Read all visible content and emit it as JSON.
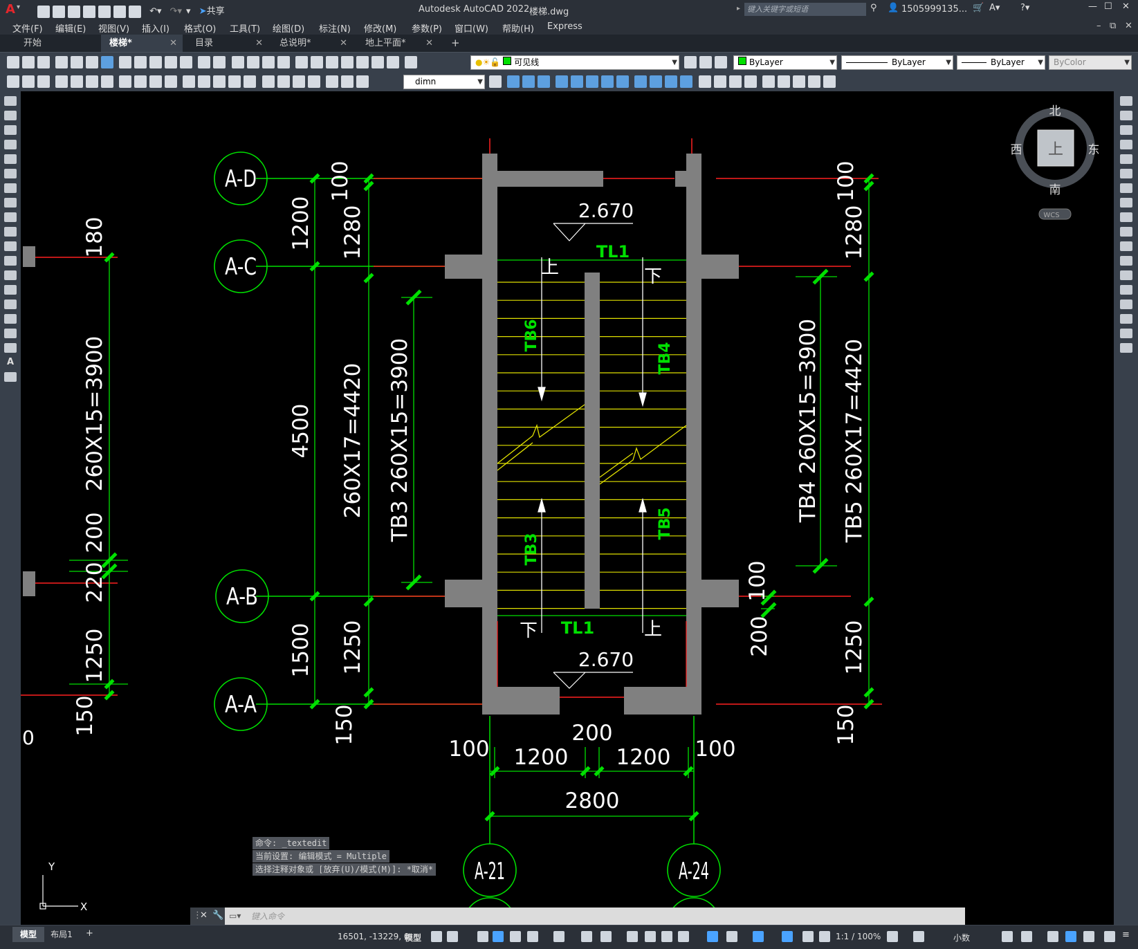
{
  "app": {
    "logo": "A",
    "title": "Autodesk AutoCAD 2022",
    "filename": "楼梯.dwg",
    "share": "共享",
    "search_placeholder": "键入关键字或短语",
    "user": "1505999135...",
    "colors": {
      "accent": "#d9262c",
      "green": "#00e000",
      "red": "#ff2020",
      "yellow": "#e0e000",
      "wall": "#808080"
    }
  },
  "menu": [
    "文件(F)",
    "编辑(E)",
    "视图(V)",
    "插入(I)",
    "格式(O)",
    "工具(T)",
    "绘图(D)",
    "标注(N)",
    "修改(M)",
    "参数(P)",
    "窗口(W)",
    "帮助(H)",
    "Express"
  ],
  "tabs": [
    {
      "label": "开始"
    },
    {
      "label": "楼梯*"
    },
    {
      "label": "目录"
    },
    {
      "label": "总说明*"
    },
    {
      "label": "地上平面*"
    }
  ],
  "toolbar": {
    "layer": "可见线",
    "color": "ByLayer",
    "linetype": "ByLayer",
    "lineweight": "ByLayer",
    "plotstyle": "ByColor",
    "dimstyle": "dimn"
  },
  "viewcube": {
    "north": "北",
    "south": "南",
    "east": "东",
    "west": "西",
    "top": "上",
    "wcs": "WCS"
  },
  "drawing": {
    "axes_left": [
      "A-D",
      "A-C",
      "A-B",
      "A-A"
    ],
    "axes_bottom": [
      "A-21",
      "A-24"
    ],
    "elev_top": "2.670",
    "elev_bottom": "2.670",
    "beam_top": "TL1",
    "beam_bottom": "TL1",
    "stairs": [
      "TB6",
      "TB4",
      "TB3",
      "TB5"
    ],
    "up": "上",
    "down": "下",
    "dims_col1": [
      "1200",
      "4500",
      "1500"
    ],
    "dims_col2": [
      "100",
      "1280",
      "260X17=4420",
      "1250",
      "150"
    ],
    "dims_col3": "TB3 260X15=3900",
    "dims_far_left": [
      "180",
      "260X15=3900",
      "200",
      "220",
      "1250",
      "150"
    ],
    "dims_right_inner": "TB4 260X15=3900",
    "dims_right_outer": [
      "100",
      "1280",
      "TB5 260X17=4420",
      "1250",
      "150"
    ],
    "dims_right_small": [
      "100",
      "200"
    ],
    "dims_bottom": {
      "d100a": "100",
      "d200": "200",
      "d100b": "100",
      "d1200a": "1200",
      "d1200b": "1200",
      "total": "2800"
    },
    "ucs_x": "X",
    "ucs_y": "Y"
  },
  "command": {
    "history": [
      "命令: _textedit",
      "当前设置: 编辑模式 = Multiple",
      "选择注释对象或 [放弃(U)/模式(M)]: *取消*"
    ],
    "placeholder": "键入命令"
  },
  "status": {
    "layout_tabs": [
      "模型",
      "布局1"
    ],
    "coords": "16501, -13229, 0",
    "mode": "模型",
    "scale": "1:1 / 100%",
    "units": "小数"
  }
}
